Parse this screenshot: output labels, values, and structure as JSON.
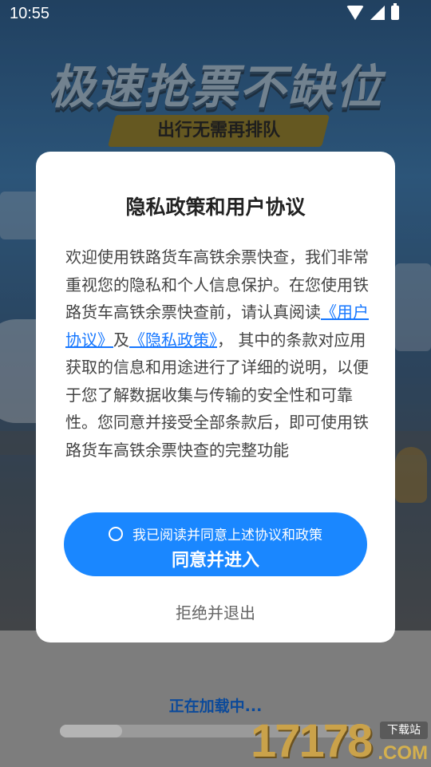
{
  "status_bar": {
    "time": "10:55"
  },
  "splash": {
    "headline": "极速抢票不缺位",
    "subheadline": "出行无需再排队"
  },
  "dialog": {
    "title": "隐私政策和用户协议",
    "body_intro": "欢迎使用铁路货车高铁余票快查，我们非常重视您的隐私和个人信息保护。在您使用铁路货车高铁余票快查前，请认真阅读",
    "link_user_agreement": "《用户协议》",
    "and_text": "及",
    "link_privacy_policy": "《隐私政策》",
    "body_rest": "， 其中的条款对应用获取的信息和用途进行了详细的说明，以便于您了解数据收集与传输的安全性和可靠性。您同意并接受全部条款后，即可使用铁路货车高铁余票快查的完整功能",
    "checkbox_label": "我已阅读并同意上述协议和政策",
    "agree_button": "同意并进入",
    "reject_button": "拒绝并退出"
  },
  "loading": {
    "text": "正在加载中...",
    "progress": 0.2
  },
  "watermark": {
    "number": "17178",
    "tag": "下载站",
    "suffix": ".COM"
  },
  "colors": {
    "primary": "#1a87ff",
    "link": "#1677ff",
    "loading_text": "#0c4a9a"
  }
}
